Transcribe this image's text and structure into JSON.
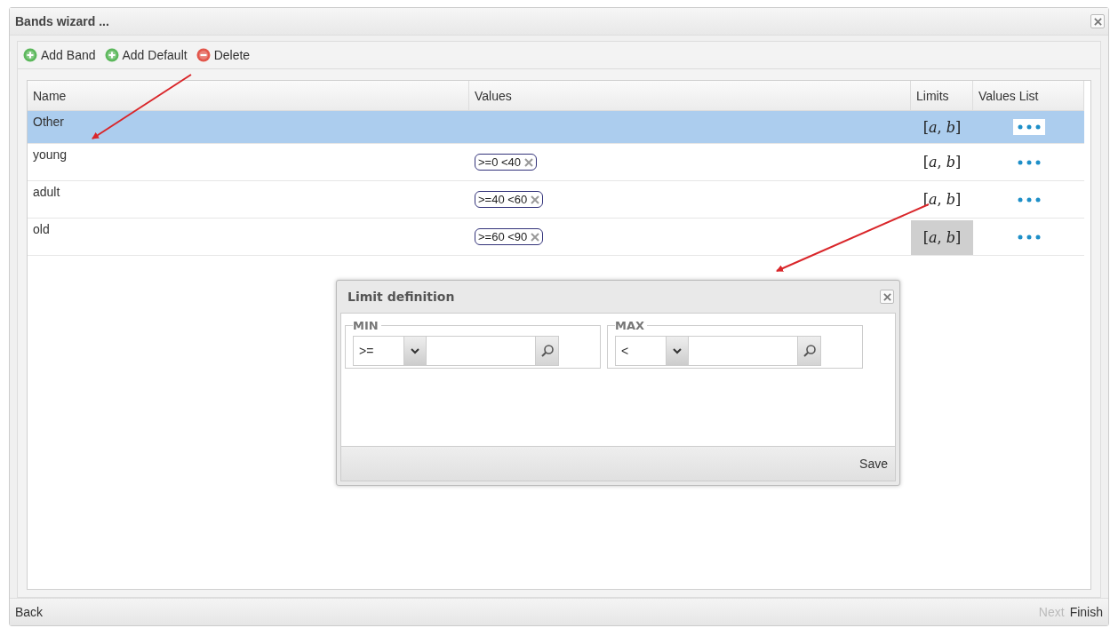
{
  "window": {
    "title": "Bands wizard ..."
  },
  "toolbar": [
    {
      "kind": "add",
      "label": "Add Band"
    },
    {
      "kind": "add",
      "label": "Add Default"
    },
    {
      "kind": "delete",
      "label": "Delete"
    }
  ],
  "table": {
    "columns": [
      "Name",
      "Values",
      "Limits",
      "Values List"
    ],
    "rows": [
      {
        "name": "Other",
        "values": [],
        "limits": "[*a*, *b*]",
        "limits_active": false,
        "selected": true
      },
      {
        "name": "young",
        "values": [
          ">=0 <40"
        ],
        "limits": "[*a*, *b*]",
        "limits_active": false,
        "selected": false
      },
      {
        "name": "adult",
        "values": [
          ">=40 <60"
        ],
        "limits": "[*a*, *b*]",
        "limits_active": false,
        "selected": false
      },
      {
        "name": "old",
        "values": [
          ">=60 <90"
        ],
        "limits": "[*a*, *b*]",
        "limits_active": true,
        "selected": false
      }
    ]
  },
  "dialog": {
    "title": "Limit definition",
    "groups": [
      {
        "legend": "MIN",
        "operator": ">="
      },
      {
        "legend": "MAX",
        "operator": "<"
      }
    ],
    "save": "Save"
  },
  "footer": {
    "back": "Back",
    "next": {
      "label": "Next",
      "disabled": true
    },
    "finish": "Finish"
  }
}
